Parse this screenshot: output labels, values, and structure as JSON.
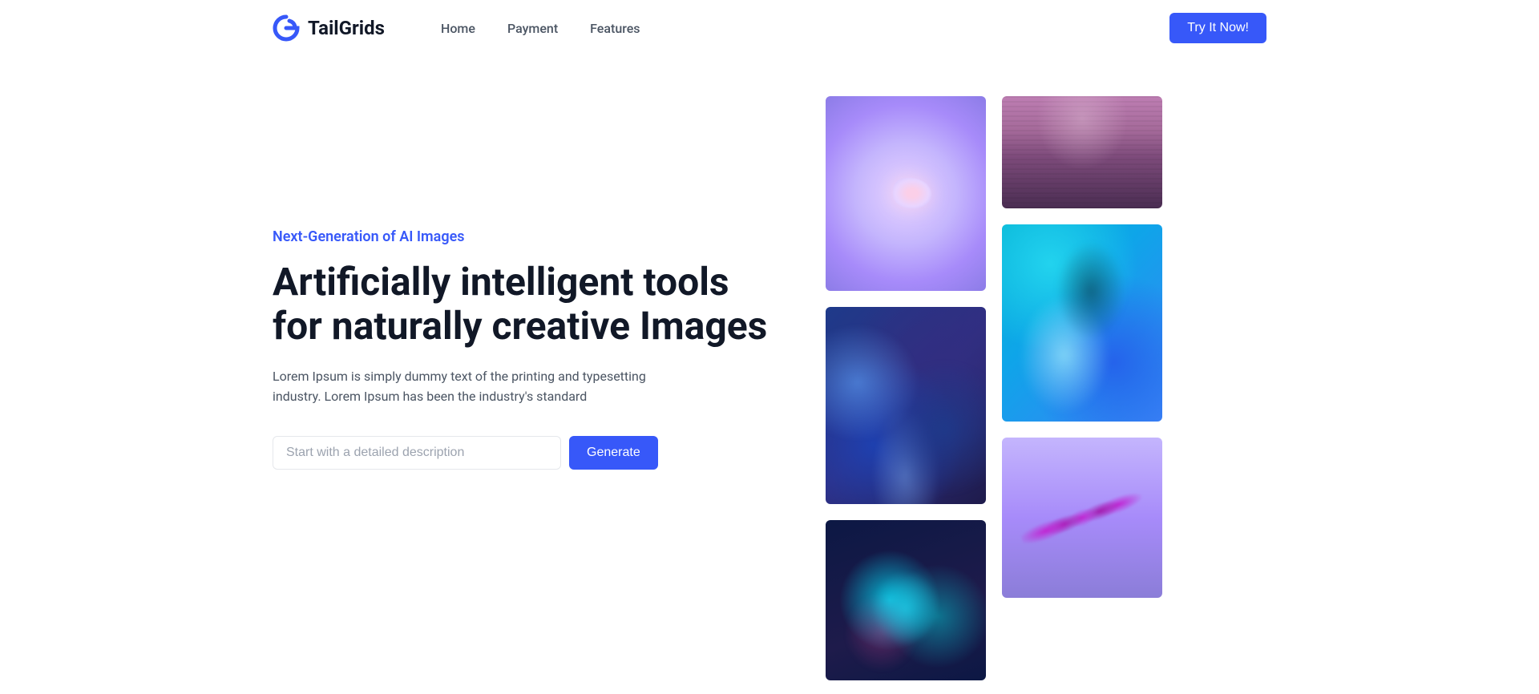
{
  "brand": {
    "name": "TailGrids"
  },
  "nav": {
    "items": [
      {
        "label": "Home"
      },
      {
        "label": "Payment"
      },
      {
        "label": "Features"
      }
    ]
  },
  "cta": {
    "label": "Try It Now!"
  },
  "hero": {
    "eyebrow": "Next-Generation of AI Images",
    "headline": "Artificially intelligent tools for naturally creative Images",
    "description": "Lorem Ipsum is simply dummy text of the printing and typesetting industry. Lorem Ipsum has been the industry's standard",
    "input_placeholder": "Start with a detailed description",
    "generate_label": "Generate"
  },
  "gallery": {
    "col1": [
      {
        "name": "brain-abstract"
      },
      {
        "name": "liquid-metal-blue"
      },
      {
        "name": "oil-slick-dark"
      }
    ],
    "col2": [
      {
        "name": "volcano-purple"
      },
      {
        "name": "cyan-wave"
      },
      {
        "name": "purple-spiral"
      }
    ]
  }
}
